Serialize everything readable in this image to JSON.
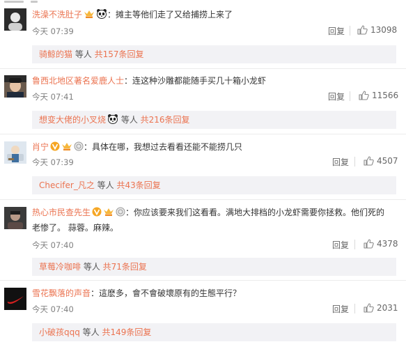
{
  "comments": [
    {
      "username": "洗澡不洗肚子",
      "text": "：摊主等他们走了又给捕捞上来了",
      "time": "今天 07:39",
      "reply_label": "回复",
      "likes": "13098",
      "sub": {
        "user": "骑鲸的猫",
        "mid": " 等人 ",
        "count": "共157条回复"
      }
    },
    {
      "username": "鲁西北地区著名爱鹿人士",
      "text": "：连这种沙雕都能随手买几十箱小龙虾",
      "time": "今天 07:41",
      "reply_label": "回复",
      "likes": "11566",
      "sub": {
        "user": "想变大佬的小叉烧",
        "mid": " 等人 ",
        "count": "共216条回复"
      }
    },
    {
      "username": "肖宁",
      "text": "：具体在哪，我想过去看看还能不能捞几只",
      "time": "今天 07:39",
      "reply_label": "回复",
      "likes": "4507",
      "sub": {
        "user": "Checifer_凡之",
        "mid": " 等人 ",
        "count": "共43条回复"
      }
    },
    {
      "username": "热心市民查先生",
      "text": "：你应该要来我们这看看。满地大排档的小龙虾需要你拯救。他们死的",
      "text2": "老惨了。 蒜蓉。麻辣。",
      "time": "今天 07:40",
      "reply_label": "回复",
      "likes": "4378",
      "sub": {
        "user": "草莓冷咖啡",
        "mid": " 等人 ",
        "count": "共71条回复"
      }
    },
    {
      "username": "雪花飘落的声音",
      "text": "：這麽多，會不會破壞原有的生態平行？",
      "time": "今天 07:40",
      "reply_label": "回复",
      "likes": "2031",
      "sub": {
        "user": "小破孩qqq",
        "mid": " 等人 ",
        "count": "共149条回复"
      }
    }
  ],
  "icons": {
    "like": "thumbs-up-icon",
    "panda": "panda-emoji-icon",
    "vip": "vip-crown-icon",
    "verified": "verified-v-icon",
    "member": "member-level-icon"
  },
  "colors": {
    "username": "#eb7350",
    "text": "#333333",
    "meta": "#808080",
    "sub_bg": "#f2f2f5"
  }
}
